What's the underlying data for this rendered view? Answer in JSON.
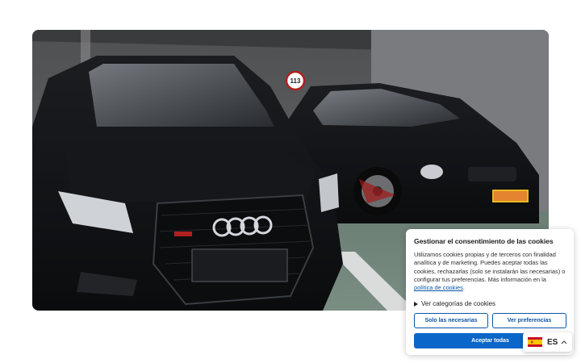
{
  "photo": {
    "subject": "two black cars parked in an underground garage",
    "sign_text": "113"
  },
  "cookie_banner": {
    "title": "Gestionar el consentimiento de las cookies",
    "body": "Utilizamos cookies propias y de terceros con finalidad analítica y de marketing. Puedes aceptar todas las cookies, rechazarlas (solo se instalarán las necesarias) o configurar tus preferencias. Más información en la ",
    "policy_link": "política de cookies",
    "body_end": ".",
    "details_toggle": "Ver categorías de cookies",
    "necessary_button": "Solo las necesarias",
    "preferences_button": "Ver preferencias",
    "accept_button": "Aceptar todas"
  },
  "language_switcher": {
    "code": "ES",
    "flag_icon": "spain-flag-icon"
  },
  "colors": {
    "accent": "#0a66c8",
    "link": "#0a55a6"
  }
}
